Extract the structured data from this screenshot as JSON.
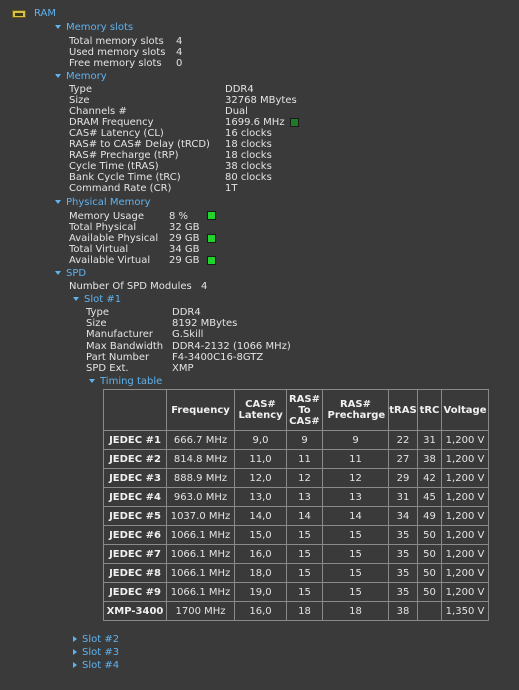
{
  "root": {
    "label": "RAM"
  },
  "memory_slots": {
    "title": "Memory slots",
    "items": [
      {
        "key": "Total memory slots",
        "value": "4"
      },
      {
        "key": "Used memory slots",
        "value": "4"
      },
      {
        "key": "Free memory slots",
        "value": "0"
      }
    ]
  },
  "memory": {
    "title": "Memory",
    "items": [
      {
        "key": "Type",
        "value": "DDR4"
      },
      {
        "key": "Size",
        "value": "32768 MBytes"
      },
      {
        "key": "Channels #",
        "value": "Dual"
      },
      {
        "key": "DRAM Frequency",
        "value": "1699.6 MHz"
      },
      {
        "key": "CAS# Latency (CL)",
        "value": "16 clocks"
      },
      {
        "key": "RAS# to CAS# Delay (tRCD)",
        "value": "18 clocks"
      },
      {
        "key": "RAS# Precharge (tRP)",
        "value": "18 clocks"
      },
      {
        "key": "Cycle Time (tRAS)",
        "value": "38 clocks"
      },
      {
        "key": "Bank Cycle Time (tRC)",
        "value": "80 clocks"
      },
      {
        "key": "Command Rate (CR)",
        "value": "1T"
      }
    ]
  },
  "physical_memory": {
    "title": "Physical Memory",
    "items": [
      {
        "key": "Memory Usage",
        "value": "8 %"
      },
      {
        "key": "Total Physical",
        "value": "32 GB"
      },
      {
        "key": "Available Physical",
        "value": "29 GB"
      },
      {
        "key": "Total Virtual",
        "value": "34 GB"
      },
      {
        "key": "Available Virtual",
        "value": "29 GB"
      }
    ]
  },
  "spd": {
    "title": "SPD",
    "modules_key": "Number Of SPD Modules",
    "modules_value": "4",
    "slot1": {
      "title": "Slot #1",
      "items": [
        {
          "key": "Type",
          "value": "DDR4"
        },
        {
          "key": "Size",
          "value": "8192 MBytes"
        },
        {
          "key": "Manufacturer",
          "value": "G.Skill"
        },
        {
          "key": "Max Bandwidth",
          "value": "DDR4-2132 (1066 MHz)"
        },
        {
          "key": "Part Number",
          "value": "F4-3400C16-8GTZ"
        },
        {
          "key": "SPD Ext.",
          "value": "XMP"
        }
      ],
      "timing_title": "Timing table"
    },
    "other_slots": [
      "Slot #2",
      "Slot #3",
      "Slot #4"
    ]
  },
  "timing_table": {
    "headers": [
      "Frequency",
      "CAS# Latency",
      "RAS# To CAS#",
      "RAS# Precharge",
      "tRAS",
      "tRC",
      "Voltage"
    ],
    "rows": [
      {
        "label": "JEDEC #1",
        "cells": [
          "666.7 MHz",
          "9,0",
          "9",
          "9",
          "22",
          "31",
          "1,200 V"
        ]
      },
      {
        "label": "JEDEC #2",
        "cells": [
          "814.8 MHz",
          "11,0",
          "11",
          "11",
          "27",
          "38",
          "1,200 V"
        ]
      },
      {
        "label": "JEDEC #3",
        "cells": [
          "888.9 MHz",
          "12,0",
          "12",
          "12",
          "29",
          "42",
          "1,200 V"
        ]
      },
      {
        "label": "JEDEC #4",
        "cells": [
          "963.0 MHz",
          "13,0",
          "13",
          "13",
          "31",
          "45",
          "1,200 V"
        ]
      },
      {
        "label": "JEDEC #5",
        "cells": [
          "1037.0 MHz",
          "14,0",
          "14",
          "14",
          "34",
          "49",
          "1,200 V"
        ]
      },
      {
        "label": "JEDEC #6",
        "cells": [
          "1066.1 MHz",
          "15,0",
          "15",
          "15",
          "35",
          "50",
          "1,200 V"
        ]
      },
      {
        "label": "JEDEC #7",
        "cells": [
          "1066.1 MHz",
          "16,0",
          "15",
          "15",
          "35",
          "50",
          "1,200 V"
        ]
      },
      {
        "label": "JEDEC #8",
        "cells": [
          "1066.1 MHz",
          "18,0",
          "15",
          "15",
          "35",
          "50",
          "1,200 V"
        ]
      },
      {
        "label": "JEDEC #9",
        "cells": [
          "1066.1 MHz",
          "19,0",
          "15",
          "15",
          "35",
          "50",
          "1,200 V"
        ]
      },
      {
        "label": "XMP-3400",
        "cells": [
          "1700 MHz",
          "16,0",
          "18",
          "18",
          "38",
          "",
          "1,350 V"
        ]
      }
    ]
  },
  "colors": {
    "accent": "#5fb3ef",
    "indicator": "#22d32f",
    "background": "#3a3a3a"
  }
}
